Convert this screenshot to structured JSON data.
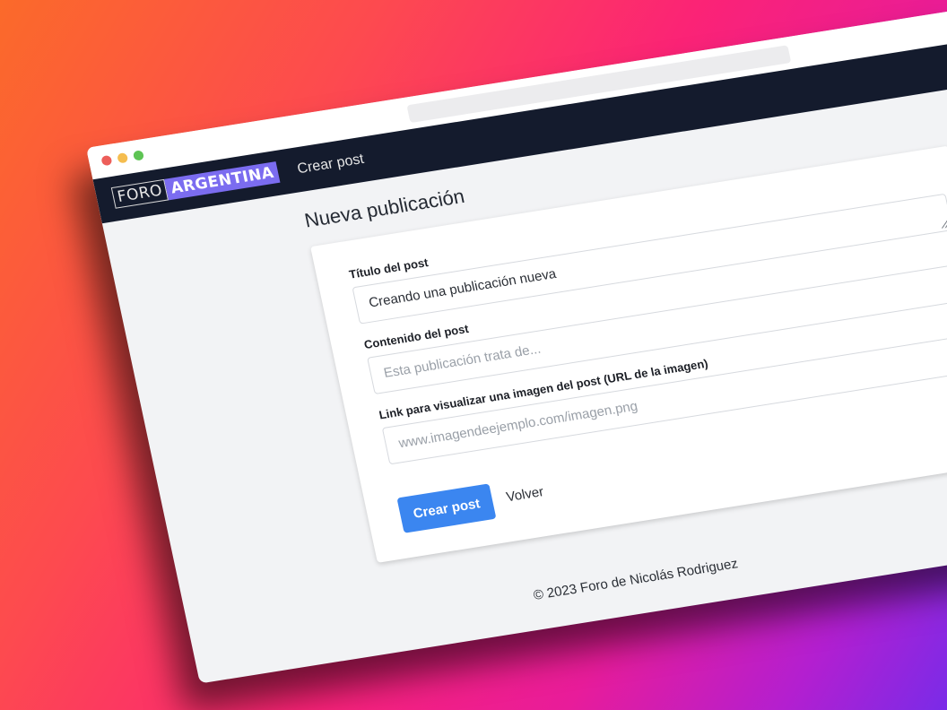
{
  "navbar": {
    "logo": {
      "part1": "FORO",
      "part2": "ARGENTINA"
    },
    "link": "Crear post"
  },
  "page": {
    "title": "Nueva publicación"
  },
  "form": {
    "title_label": "Título del post",
    "title_value": "Creando una publicación nueva",
    "content_label": "Contenido del post",
    "content_placeholder": "Esta publicación trata de...",
    "image_label": "Link para visualizar una imagen del post (URL de la imagen)",
    "image_placeholder": "www.imagendeejemplo.com/imagen.png",
    "submit_label": "Crear post",
    "back_label": "Volver"
  },
  "footer": {
    "text": "© 2023 Foro de Nicolás Rodriguez"
  },
  "colors": {
    "navbar": "#141b2d",
    "primary_button": "#3b86f0",
    "logo_accent": "#7b6cf0"
  }
}
